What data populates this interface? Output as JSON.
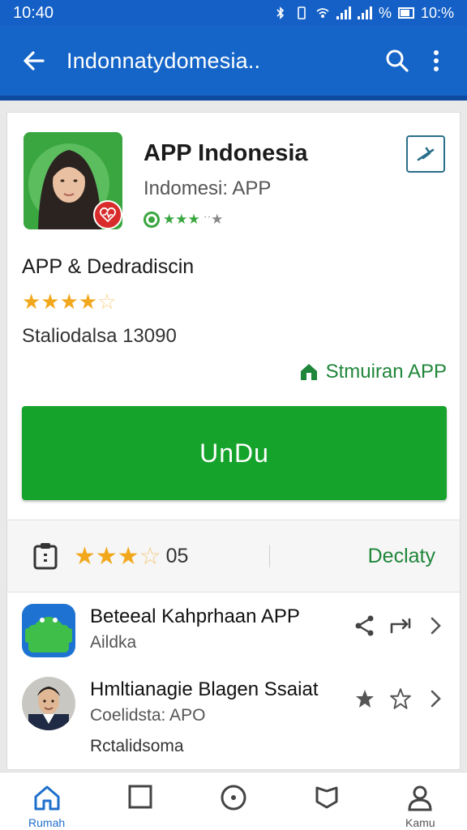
{
  "status_bar": {
    "time": "10:40",
    "battery": "10:%",
    "icons": [
      "bluetooth-icon",
      "vibrate-icon",
      "wifi-icon",
      "signal-icon",
      "battery-icon"
    ]
  },
  "app_bar": {
    "title": "Indonnatydomesia..",
    "icons": [
      "back-arrow-icon",
      "search-icon",
      "more-vert-icon"
    ]
  },
  "app": {
    "name": "APP Indonesia",
    "developer": "Indomesi: APP",
    "mini_rating_stars": "★★★",
    "mini_rating_rest": "ˑˑ★",
    "install_icon": "airplane-icon"
  },
  "section": {
    "title": "APP & Dedradiscin",
    "stars_full": "★★★★",
    "stars_empty": "☆",
    "downloads": "Staliodalsa 13090"
  },
  "store_link": {
    "label": "Stmuiran APP",
    "icon": "store-icon"
  },
  "primary_button": {
    "label": "UnDu"
  },
  "stats": {
    "stars_full": "★★★",
    "stars_empty": "☆",
    "rating_count": "05",
    "detail_link": "Declaty"
  },
  "list": [
    {
      "title": "Beteeal Kahprhaan APP",
      "subtitle": "Aildka",
      "extra": "",
      "actions": [
        "share-icon",
        "repost-icon",
        "chevron-right-icon"
      ]
    },
    {
      "title": "Hmltianagie Blagen Ssaiat",
      "subtitle": "Coelidsta: APO",
      "extra": "Rctalidsoma",
      "actions": [
        "star-filled-icon",
        "star-outline-icon",
        "chevron-right-icon"
      ]
    }
  ],
  "bottom_nav": [
    {
      "label": "Rumah",
      "icon": "home-icon",
      "active": true
    },
    {
      "label": "",
      "icon": "square-icon",
      "active": false
    },
    {
      "label": "",
      "icon": "circle-target-icon",
      "active": false
    },
    {
      "label": "",
      "icon": "bookmark-shield-icon",
      "active": false
    },
    {
      "label": "Kamu",
      "icon": "person-icon",
      "active": false
    }
  ],
  "colors": {
    "appbar": "#1565c8",
    "primary_green": "#16a32c",
    "link_green": "#20863a",
    "star": "#f2a81d"
  }
}
